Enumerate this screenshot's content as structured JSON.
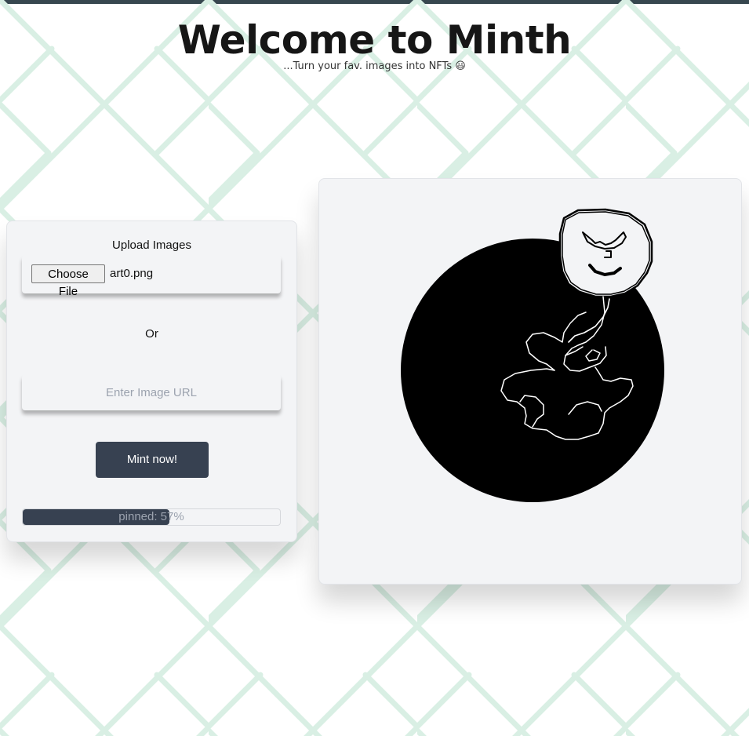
{
  "header": {
    "title": "Welcome to Minth",
    "subtitle": "...Turn your fav. images into NFTs 😃"
  },
  "upload": {
    "heading": "Upload Images",
    "choose_file_label": "Choose File",
    "file_name": "art0.png",
    "or_label": "Or",
    "url_placeholder": "Enter Image URL",
    "mint_label": "Mint now!",
    "progress_text": "pinned: 57%",
    "progress_fraction": 0.57
  },
  "preview": {
    "image_description": "preview-image"
  },
  "colors": {
    "accent": "#374151",
    "card": "#f3f4f6",
    "pattern": "#d6efe4",
    "topbar": "#37474f"
  }
}
